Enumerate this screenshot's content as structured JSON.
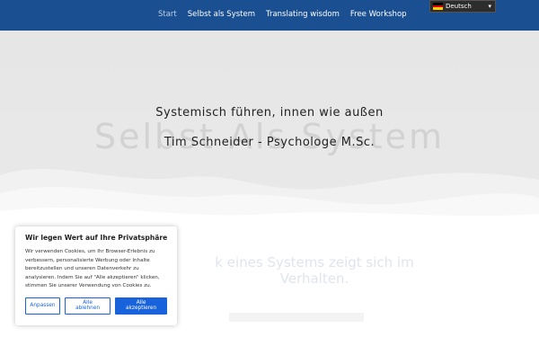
{
  "nav": {
    "items": [
      {
        "label": "Start",
        "active": true
      },
      {
        "label": "Selbst als System"
      },
      {
        "label": "Translating wisdom"
      },
      {
        "label": "Free Workshop"
      }
    ]
  },
  "language": {
    "label": "Deutsch",
    "flag_icon": "germany-flag-icon"
  },
  "hero": {
    "watermark": "Selbst Als System",
    "line1": "Systemisch führen, innen wie außen",
    "line2": "Tim Schneider - Psychologe M.Sc."
  },
  "below": {
    "line1": "k eines Systems zeigt sich im",
    "line2": "Verhalten."
  },
  "cookie": {
    "title": "Wir legen Wert auf Ihre Privatsphäre",
    "text": "Wir verwenden Cookies, um Ihr Browser-Erlebnis zu verbessern, personalisierte Werbung oder Inhalte bereitzustellen und unseren Datenverkehr zu analysieren. Indem Sie auf \"Alle akzeptieren\" klicken, stimmen Sie unserer Verwendung von Cookies zu.",
    "customize": "Anpassen",
    "reject": "Alle ablehnen",
    "accept": "Alle akzeptieren"
  },
  "colors": {
    "header": "#1a4f91",
    "accent": "#1863dc",
    "hero_bg": "#e6e6e6"
  }
}
